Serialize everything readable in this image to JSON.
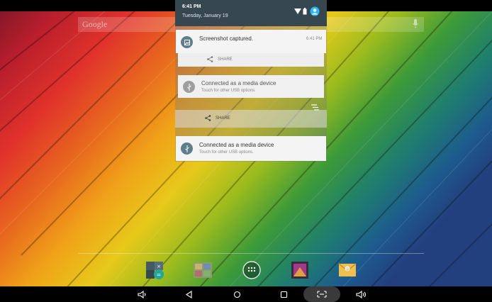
{
  "status": {
    "time": "6:41 PM",
    "date": "Tuesday, January 19"
  },
  "search": {
    "label": "Google"
  },
  "notifications": [
    {
      "title": "Screenshot captured.",
      "time": "6:41 PM",
      "icon": "image-icon",
      "action": "SHARE"
    },
    {
      "title": "Connected as a media device",
      "subtitle": "Touch for other USB options.",
      "icon": "usb-icon"
    },
    {
      "action": "SHARE"
    },
    {
      "title": "Connected as a media device",
      "subtitle": "Touch for other USB options.",
      "icon": "usb-icon"
    }
  ],
  "dock": [
    {
      "name": "calculator-icon"
    },
    {
      "name": "gallery-icon"
    },
    {
      "name": "all-apps-icon"
    },
    {
      "name": "photo-icon"
    },
    {
      "name": "email-icon"
    }
  ],
  "navbar": [
    {
      "name": "volume-down-icon"
    },
    {
      "name": "back-icon"
    },
    {
      "name": "home-icon"
    },
    {
      "name": "recents-icon"
    },
    {
      "name": "screenshot-icon"
    },
    {
      "name": "volume-up-icon"
    }
  ],
  "colors": {
    "shade_header": "#37474f",
    "icon_circle": "#607d8b",
    "card": "#f4f4f4",
    "navbar": "#000000"
  }
}
